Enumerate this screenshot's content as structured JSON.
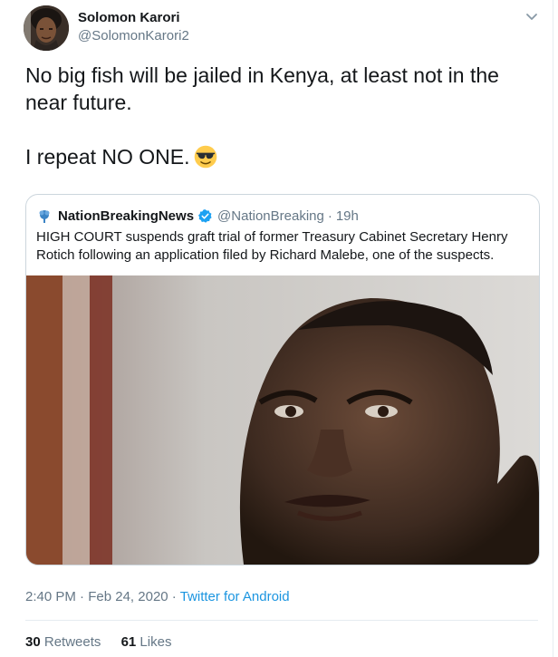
{
  "author": {
    "display_name": "Solomon Karori",
    "handle": "@SolomonKarori2"
  },
  "tweet": {
    "text": "No big fish will be jailed in Kenya, at least not in the near future.\n\nI repeat NO ONE.",
    "emoji": "smiling-face-with-sunglasses"
  },
  "quoted_tweet": {
    "display_name": "NationBreakingNews",
    "verified": true,
    "handle": "@NationBreaking",
    "separator": "·",
    "time": "19h",
    "text": "HIGH COURT suspends graft trial of former Treasury Cabinet Secretary Henry Rotich following an application filed by Richard Malebe, one of the suspects."
  },
  "meta": {
    "time": "2:40 PM",
    "sep1": "·",
    "date": "Feb 24, 2020",
    "sep2": "·",
    "source": "Twitter for Android"
  },
  "stats": {
    "retweets_count": "30",
    "retweets_label": "Retweets",
    "likes_count": "61",
    "likes_label": "Likes"
  },
  "colors": {
    "link": "#1b95e0",
    "secondary_text": "#657786",
    "border": "#ccd6dd",
    "verified": "#1da1f2"
  }
}
